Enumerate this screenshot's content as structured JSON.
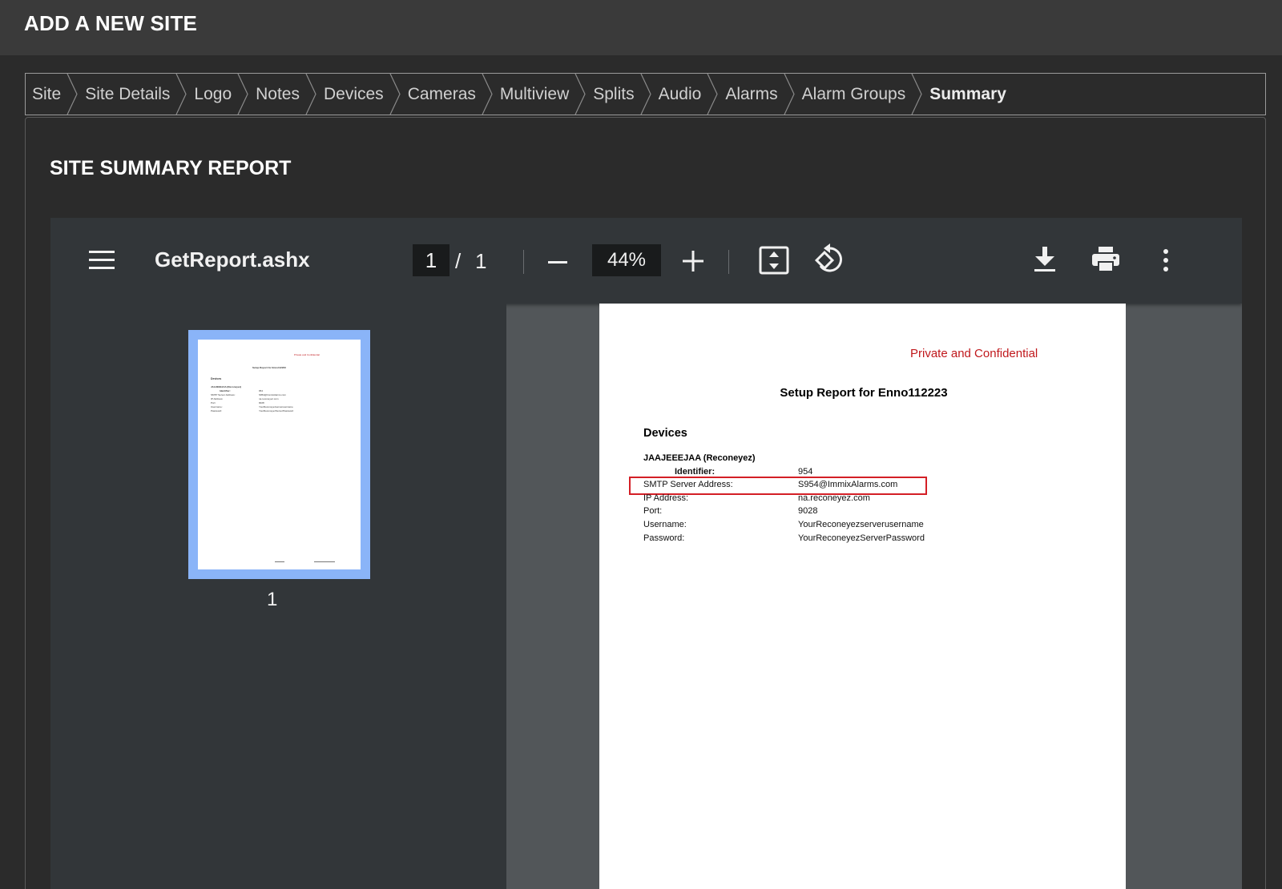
{
  "header": {
    "title": "ADD A NEW SITE"
  },
  "breadcrumb": {
    "items": [
      "Site",
      "Site Details",
      "Logo",
      "Notes",
      "Devices",
      "Cameras",
      "Multiview",
      "Splits",
      "Audio",
      "Alarms",
      "Alarm Groups",
      "Summary"
    ],
    "active": "Summary"
  },
  "panel": {
    "title": "SITE SUMMARY REPORT"
  },
  "viewer": {
    "file_name": "GetReport.ashx",
    "current_page": "1",
    "page_separator": "/",
    "total_pages": "1",
    "zoom": "44%",
    "thumbnail_label": "1",
    "icons": [
      "menu-icon",
      "zoom-out-icon",
      "zoom-in-icon",
      "fit-page-icon",
      "rotate-icon",
      "download-icon",
      "print-icon",
      "more-options-icon"
    ],
    "accent_color": "#8ab4f8"
  },
  "report": {
    "confidential": "Private and Confidential",
    "title": "Setup Report for Enno112223",
    "section": "Devices",
    "device_name": "JAAJEEEJAA (Reconeyez)",
    "identifier_label": "Identifier:",
    "identifier_value": "954",
    "rows": [
      {
        "label": "SMTP Server Address:",
        "value": "S954@ImmixAlarms.com"
      },
      {
        "label": "IP Address:",
        "value": "na.reconeyez.com"
      },
      {
        "label": "Port:",
        "value": "9028"
      },
      {
        "label": "Username:",
        "value": "YourReconeyezserverusername"
      },
      {
        "label": "Password:",
        "value": "YourReconeyezServerPassword"
      }
    ],
    "highlight_color": "#d41f26"
  }
}
